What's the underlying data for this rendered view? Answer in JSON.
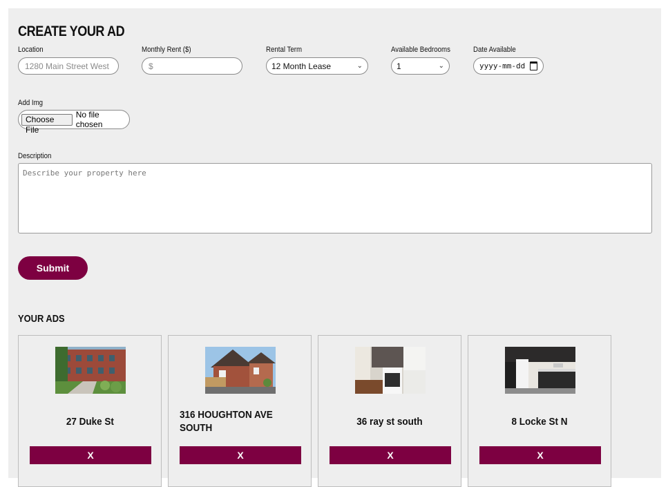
{
  "form": {
    "title": "CREATE YOUR AD",
    "location": {
      "label": "Location",
      "placeholder": "1280 Main Street West"
    },
    "rent": {
      "label": "Monthly Rent ($)",
      "placeholder": "$"
    },
    "term": {
      "label": "Rental Term",
      "value": "12 Month Lease"
    },
    "bedrooms": {
      "label": "Available Bedrooms",
      "value": "1"
    },
    "date": {
      "label": "Date Available",
      "value": "yyyy-mm-dd"
    },
    "image": {
      "label": "Add Img",
      "button": "Choose File",
      "status": "No file chosen"
    },
    "description": {
      "label": "Description",
      "placeholder": "Describe your property here"
    },
    "submit": "Submit"
  },
  "ads": {
    "title": "YOUR ADS",
    "items": [
      {
        "address": "27 Duke St",
        "delete": "X",
        "photo": "brick-apartment-exterior"
      },
      {
        "address": "316 HOUGHTON AVE SOUTH",
        "delete": "X",
        "photo": "brick-house-exterior"
      },
      {
        "address": "36 ray st south",
        "delete": "X",
        "photo": "kitchen-interior"
      },
      {
        "address": "8 Locke St N",
        "delete": "X",
        "photo": "dark-kitchen-interior"
      }
    ]
  },
  "colors": {
    "accent": "#7d0041",
    "panel": "#eeeeee"
  }
}
